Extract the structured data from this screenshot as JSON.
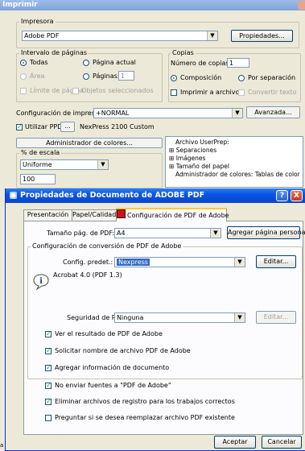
{
  "print_dialog": {
    "title": "Imprimir",
    "printer_group": "Impresora",
    "printer_name": "Adobe PDF",
    "properties_button": "Propiedades...",
    "range_group": "Intervalo de páginas",
    "range_all": "Todas",
    "range_current": "Página actual",
    "range_area": "Área",
    "range_pages": "Páginas:",
    "pages_value": "1",
    "range_limit": "Límite de página",
    "range_selected_objects": "Objetos seleccionados",
    "copies_group": "Copias",
    "copies_label": "Número de copias:",
    "copies_value": "1",
    "collate": "Composición",
    "by_separation": "Por separación",
    "print_to_file": "Imprimir a archivo",
    "convert_text": "Convertir texto",
    "config_label": "Configuración de impresión:",
    "config_value": "+NORMAL",
    "advanced_button": "Avanzada...",
    "use_ppd": "Utilizar PPD:",
    "ppd_button": "...",
    "ppd_value": "NexPress 2100 Custom",
    "color_admin_button": "Administrador de colores...",
    "scale_group": "% de escala",
    "scale_mode": "Uniforme",
    "scale_value": "100",
    "tree": [
      {
        "prefix": "",
        "text": "Archivo UserPrep:"
      },
      {
        "prefix": "⊞",
        "text": "Separaciones"
      },
      {
        "prefix": "⊞",
        "text": "Imágenes"
      },
      {
        "prefix": "⊞",
        "text": "Tamaño del papel"
      },
      {
        "prefix": "",
        "text": "Administrador de colores: Tablas de color"
      }
    ],
    "bottom_left_fragment": "a p"
  },
  "pdf_dialog": {
    "title": "Propiedades de Documento de ADOBE PDF",
    "help_icon": "?",
    "close_icon": "X",
    "tabs": [
      "Presentación",
      "Papel/Calidad",
      "Configuración de PDF de Adobe"
    ],
    "page_size_label": "Tamaño pág. de PDF:",
    "page_size_value": "A4",
    "add_page_button": "Agregar página personal...",
    "conversion_group": "Configuración de conversión de PDF de Adobe",
    "defaults_label": "Config. predet.:",
    "defaults_value": "Nexpress",
    "edit_button": "Editar...",
    "info_text": "Acrobat 4.0 (PDF 1.3)",
    "security_label": "Seguridad de PDF:",
    "security_value": "Ninguna",
    "edit_button_2": "Editar...",
    "options": [
      {
        "label": "Ver el resultado de PDF de Adobe",
        "checked": true
      },
      {
        "label": "Solicitar nombre de archivo PDF de Adobe",
        "checked": true
      },
      {
        "label": "Agregar información de documento",
        "checked": true
      }
    ],
    "outer_options": [
      {
        "label": "No enviar fuentes a \"PDF de Adobe\"",
        "checked": true
      },
      {
        "label": "Eliminar archivos de registro para los trabajos correctos",
        "checked": true
      },
      {
        "label": "Preguntar si se desea reemplazar archivo PDF existente",
        "checked": false
      }
    ],
    "accept_button": "Aceptar",
    "cancel_button": "Cancelar"
  },
  "colors": {
    "title_active": "#0a54e6",
    "title_inactive": "#8eb0e4",
    "face": "#ece9d8",
    "close_red": "#d9441c"
  }
}
